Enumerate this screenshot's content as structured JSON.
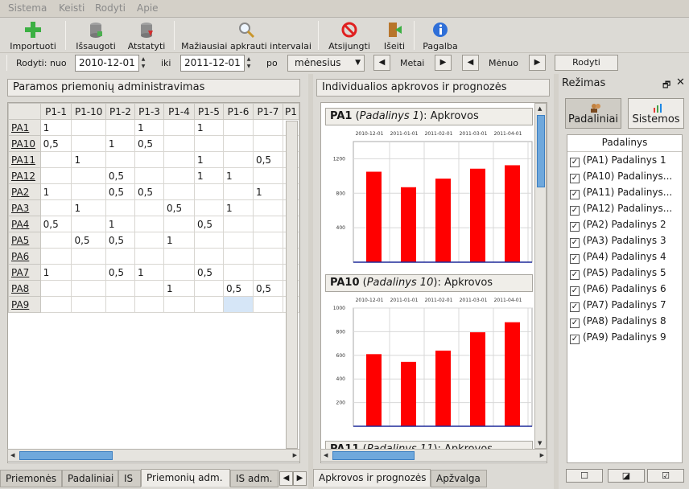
{
  "menu": [
    "Sistema",
    "Keisti",
    "Rodyti",
    "Apie"
  ],
  "toolbar": {
    "import": "Importuoti",
    "save": "Išsaugoti",
    "restore": "Atstatyti",
    "min_intervals": "Mažiausiai apkrauti intervalai",
    "disconnect": "Atsijungti",
    "exit": "Išeiti",
    "help": "Pagalba"
  },
  "filter": {
    "show_from_label": "Rodyti: nuo",
    "from_date": "2010-12-01",
    "to_label": "iki",
    "to_date": "2011-12-01",
    "by_label": "po",
    "period": "mėnesius",
    "year_label": "Metai",
    "month_label": "Mėnuo",
    "show_button": "Rodyti"
  },
  "left_panel": {
    "title": "Paramos priemonių administravimas",
    "columns": [
      "P1-1",
      "P1-10",
      "P1-2",
      "P1-3",
      "P1-4",
      "P1-5",
      "P1-6",
      "P1-7",
      "P1"
    ],
    "rows": [
      {
        "name": "PA1",
        "cells": [
          "1",
          "",
          "",
          "1",
          "",
          "1",
          "",
          "",
          ""
        ]
      },
      {
        "name": "PA10",
        "cells": [
          "0,5",
          "",
          "1",
          "0,5",
          "",
          "",
          "",
          "",
          ""
        ]
      },
      {
        "name": "PA11",
        "cells": [
          "",
          "1",
          "",
          "",
          "",
          "1",
          "",
          "0,5",
          ""
        ]
      },
      {
        "name": "PA12",
        "cells": [
          "",
          "",
          "0,5",
          "",
          "",
          "1",
          "1",
          "",
          ""
        ]
      },
      {
        "name": "PA2",
        "cells": [
          "1",
          "",
          "0,5",
          "0,5",
          "",
          "",
          "",
          "1",
          ""
        ]
      },
      {
        "name": "PA3",
        "cells": [
          "",
          "1",
          "",
          "",
          "0,5",
          "",
          "1",
          "",
          ""
        ]
      },
      {
        "name": "PA4",
        "cells": [
          "0,5",
          "",
          "1",
          "",
          "",
          "0,5",
          "",
          "",
          "0,"
        ]
      },
      {
        "name": "PA5",
        "cells": [
          "",
          "0,5",
          "0,5",
          "",
          "1",
          "",
          "",
          "",
          ""
        ]
      },
      {
        "name": "PA6",
        "cells": [
          "",
          "",
          "",
          "",
          "",
          "",
          "",
          "",
          "1"
        ]
      },
      {
        "name": "PA7",
        "cells": [
          "1",
          "",
          "0,5",
          "1",
          "",
          "0,5",
          "",
          "",
          ""
        ]
      },
      {
        "name": "PA8",
        "cells": [
          "",
          "",
          "",
          "",
          "1",
          "",
          "0,5",
          "0,5",
          "0,"
        ]
      },
      {
        "name": "PA9",
        "cells": [
          "",
          "",
          "",
          "",
          "",
          "",
          "",
          "",
          ""
        ]
      }
    ],
    "tabs": [
      "Priemonės",
      "Padaliniai",
      "IS",
      "Priemonių adm.",
      "IS adm."
    ]
  },
  "center_panel": {
    "title": "Individualios apkrovos ir prognozės",
    "tabs": [
      "Apkrovos ir prognozės",
      "Apžvalga"
    ]
  },
  "chart_data": [
    {
      "type": "bar",
      "title_code": "PA1",
      "title_name": "Padalinys 1",
      "title_suffix": ": Apkrovos",
      "x_ticks": [
        "2010-12-01",
        "2011-01-01",
        "2011-02-01",
        "2011-03-01",
        "2011-04-01",
        "20"
      ],
      "y_ticks": [
        "1200",
        "800",
        "400"
      ],
      "values": [
        1050,
        870,
        970,
        1085,
        1125
      ],
      "ylim": [
        0,
        1400
      ],
      "color": "#ff0000"
    },
    {
      "type": "bar",
      "title_code": "PA10",
      "title_name": "Padalinys 10",
      "title_suffix": ": Apkrovos",
      "x_ticks": [
        "2010-12-01",
        "2011-01-01",
        "2011-02-01",
        "2011-03-01",
        "2011-04-01",
        "20"
      ],
      "y_ticks": [
        "1000",
        "800",
        "600",
        "400",
        "200"
      ],
      "values": [
        610,
        545,
        640,
        795,
        880
      ],
      "ylim": [
        0,
        1000
      ],
      "color": "#ff0000"
    },
    {
      "type": "bar",
      "title_code": "PA11",
      "title_name": "Padalinys 11",
      "title_suffix": ": Apkrovos"
    }
  ],
  "right_panel": {
    "title": "Režimas",
    "modes": [
      "Padaliniai",
      "Sistemos"
    ],
    "list_header": "Padalinys",
    "items": [
      "(PA1) Padalinys 1",
      "(PA10) Padalinys...",
      "(PA11) Padalinys...",
      "(PA12) Padalinys...",
      "(PA2) Padalinys 2",
      "(PA3) Padalinys 3",
      "(PA4) Padalinys 4",
      "(PA5) Padalinys 5",
      "(PA6) Padalinys 6",
      "(PA7) Padalinys 7",
      "(PA8) Padalinys 8",
      "(PA9) Padalinys 9"
    ],
    "check_mark": "✓",
    "bottom_buttons": [
      "☐",
      "◪",
      "☑"
    ]
  }
}
